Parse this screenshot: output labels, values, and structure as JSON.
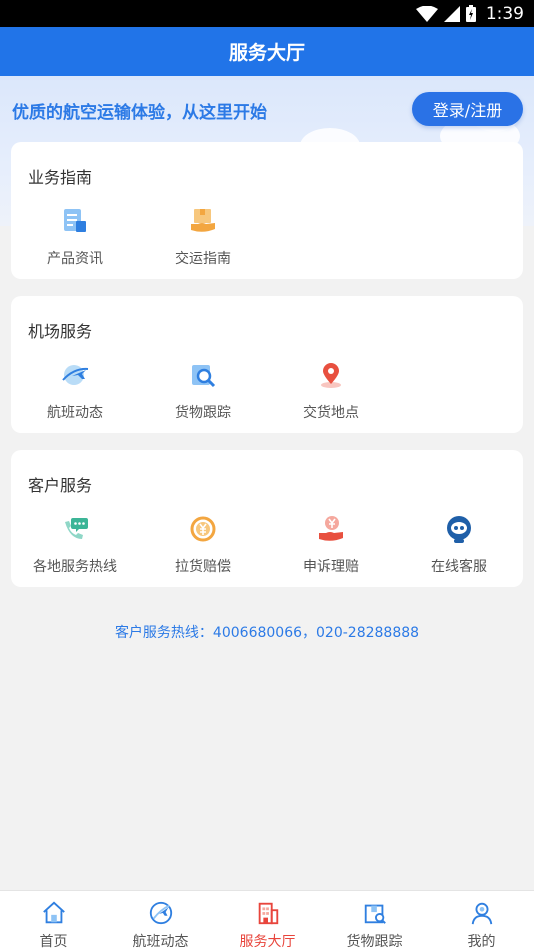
{
  "status_bar": {
    "time": "1:39"
  },
  "header": {
    "title": "服务大厅"
  },
  "banner": {
    "slogan": "优质的航空运输体验，从这里开始",
    "login_label": "登录/注册"
  },
  "sections": [
    {
      "title": "业务指南",
      "items": [
        {
          "label": "产品资讯",
          "icon": "product-info-icon"
        },
        {
          "label": "交运指南",
          "icon": "shipping-guide-icon"
        }
      ]
    },
    {
      "title": "机场服务",
      "items": [
        {
          "label": "航班动态",
          "icon": "flight-status-icon"
        },
        {
          "label": "货物跟踪",
          "icon": "cargo-tracking-icon"
        },
        {
          "label": "交货地点",
          "icon": "location-pin-icon"
        }
      ]
    },
    {
      "title": "客户服务",
      "items": [
        {
          "label": "各地服务热线",
          "icon": "phone-chat-icon"
        },
        {
          "label": "拉货赔偿",
          "icon": "yen-coin-icon"
        },
        {
          "label": "申诉理赔",
          "icon": "hand-yen-icon"
        },
        {
          "label": "在线客服",
          "icon": "robot-service-icon"
        }
      ]
    }
  ],
  "hotline": "客户服务热线：4006680066，020-28288888",
  "tabs": [
    {
      "label": "首页",
      "icon": "home-icon"
    },
    {
      "label": "航班动态",
      "icon": "globe-plane-icon"
    },
    {
      "label": "服务大厅",
      "icon": "building-icon"
    },
    {
      "label": "货物跟踪",
      "icon": "package-icon"
    },
    {
      "label": "我的",
      "icon": "user-icon"
    }
  ],
  "colors": {
    "primary": "#2174e8",
    "active_tab": "#e8453c",
    "banner_bg": "#dbe7fb",
    "hotline": "#2c7ae6"
  }
}
